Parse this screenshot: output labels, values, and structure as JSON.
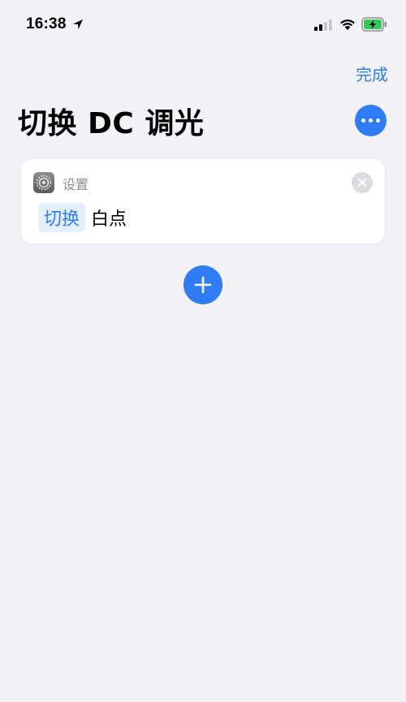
{
  "status_bar": {
    "time": "16:38",
    "icons": [
      "location-arrow-icon",
      "cellular-signal-icon",
      "wifi-icon",
      "battery-charging-icon"
    ]
  },
  "nav": {
    "done_label": "完成",
    "title": "切换 DC 调光",
    "more_icon": "ellipsis-icon"
  },
  "action": {
    "app_name": "设置",
    "app_icon": "settings-gear-icon",
    "toggle_label": "切换",
    "parameter": "白点"
  },
  "add_icon": "plus-icon",
  "colors": {
    "accent": "#2f7cf6",
    "background": "#f2f2f7",
    "card": "#ffffff",
    "secondary_text": "#8e8e93",
    "battery_green": "#34c759"
  }
}
